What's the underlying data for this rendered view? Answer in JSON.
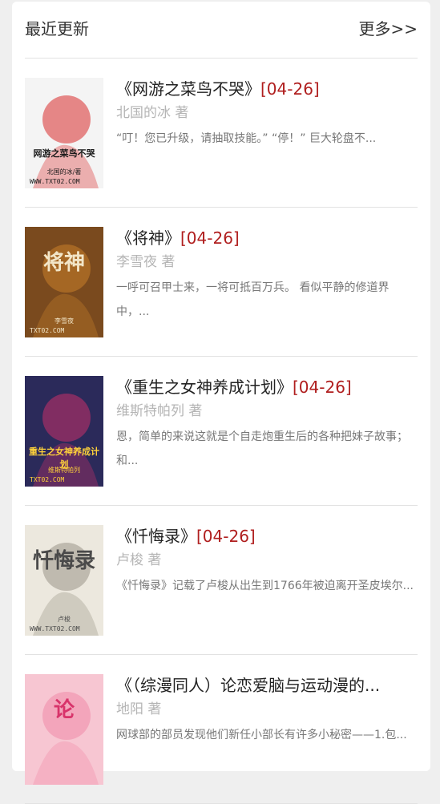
{
  "header": {
    "title": "最近更新",
    "more": "更多>>"
  },
  "books": [
    {
      "title": "《网游之菜鸟不哭》",
      "date": "[04-26]",
      "author": "北国的冰 著",
      "desc": "“叮！您已升级，请抽取技能。” “停！” 巨大轮盘不...",
      "cover": {
        "text": "网游之菜鸟不哭",
        "caption": "北国的冰/著",
        "watermark": "WWW.TXT02.COM",
        "bg": "#f4f4f4",
        "fg": "#1a1a1a",
        "accent": "#d92b2b"
      }
    },
    {
      "title": "《将神》",
      "date": "[04-26]",
      "author": "李雪夜 著",
      "desc": "一呼可召甲士来，一将可抵百万兵。 看似平静的修道界中，...",
      "cover": {
        "text": "将神",
        "caption": "李雪夜",
        "watermark": "TXT02.COM",
        "bg": "#7a4a1e",
        "fg": "#f2e6c8",
        "accent": "#c8802a"
      }
    },
    {
      "title": "《重生之女神养成计划》",
      "date": "[04-26]",
      "author": "维斯特帕列 著",
      "desc": "恩，简单的来说这就是个自走炮重生后的各种把妹子故事；和...",
      "cover": {
        "text": "重生之女神养成计划",
        "caption": "维斯特帕列",
        "watermark": "TXT02.COM",
        "bg": "#2b2a5a",
        "fg": "#ffd23a",
        "accent": "#c8306a"
      }
    },
    {
      "title": "《忏悔录》",
      "date": "[04-26]",
      "author": "卢梭 著",
      "desc": "《忏悔录》记载了卢梭从出生到1766年被迫离开圣皮埃尔...",
      "cover": {
        "text": "忏悔录",
        "caption": "卢梭",
        "watermark": "WWW.TXT02.COM",
        "bg": "#ece8de",
        "fg": "#4a4a4a",
        "accent": "#9a9488"
      }
    },
    {
      "title": "《（综漫同人）论恋爱脑与运动漫的...",
      "date": "",
      "author": "地阳 著",
      "desc": "网球部的部员发现他们新任小部长有许多小秘密——1.包...",
      "cover": {
        "text": "论",
        "caption": "",
        "watermark": "",
        "bg": "#f7c6d2",
        "fg": "#d8336a",
        "accent": "#f08aa8"
      }
    }
  ]
}
